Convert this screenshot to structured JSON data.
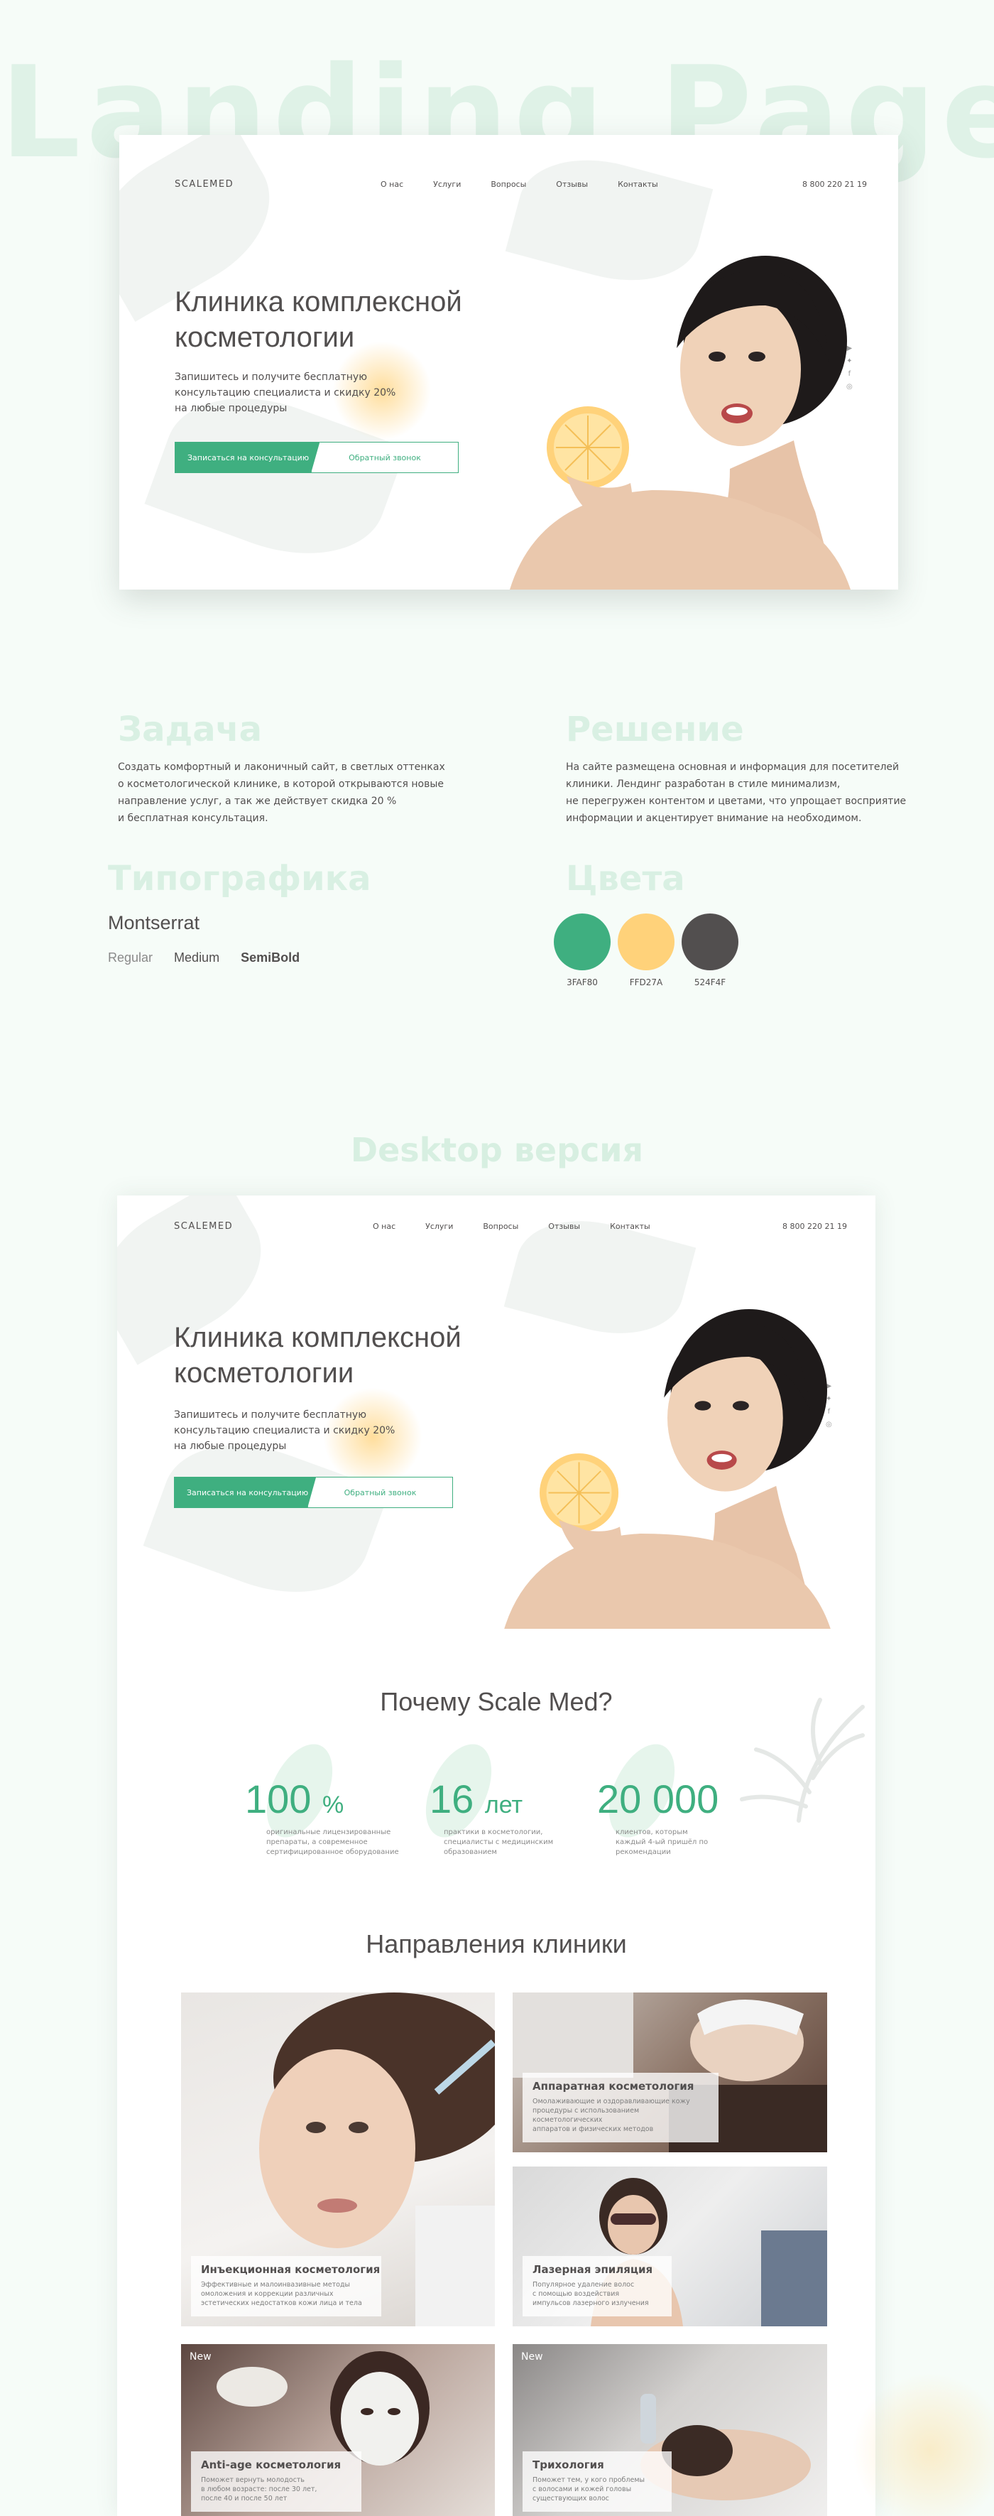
{
  "page_title": "Landing Page",
  "hero": {
    "logo": "SCALEMED",
    "nav": [
      "О нас",
      "Услуги",
      "Вопросы",
      "Отзывы",
      "Контакты"
    ],
    "phone": "8 800 220 21 19",
    "title_line1": "Клиника комплексной",
    "title_line2": "косметологии",
    "sub_line1": "Запишитесь и получите бесплатную",
    "sub_line2": "консультацию специалиста и скидку 20%",
    "sub_line3": "на любые процедуры",
    "btn_primary": "Записаться на консультацию",
    "btn_secondary": "Обратный звонок",
    "social": [
      "▶",
      "✦",
      "f",
      "◎"
    ]
  },
  "task": {
    "title": "Задача",
    "line1": "Создать комфортный и лаконичный сайт, в светлых оттенках",
    "line2": "о косметологической клинике, в которой открываются новые",
    "line3": "направление услуг, а так же действует скидка 20 %",
    "line4": "и бесплатная консультация."
  },
  "solution": {
    "title": "Решение",
    "line1": "На сайте размещена основная и информация для посетителей",
    "line2": "клиники. Лендинг разработан в стиле минимализм,",
    "line3": "не перегружен контентом и цветами, что упрощает восприятие",
    "line4": "информации и акцентирует внимание на необходимом."
  },
  "typography": {
    "title": "Типографика",
    "font": "Montserrat",
    "weights": [
      "Regular",
      "Medium",
      "SemiBold"
    ]
  },
  "colors": {
    "title": "Цвета",
    "swatches": [
      {
        "hex": "#3FAF80",
        "label": "3FAF80"
      },
      {
        "hex": "#FFD27A",
        "label": "FFD27A"
      },
      {
        "hex": "#524F4F",
        "label": "524F4F"
      }
    ]
  },
  "desktop_title": "Desktop версия",
  "why": {
    "title": "Почему Scale Med?",
    "stats": [
      {
        "num": "100",
        "unit": "%",
        "l1": "оригинальные лицензированные",
        "l2": "препараты, а современное",
        "l3": "сертифицированное оборудование"
      },
      {
        "num": "16",
        "unit": "лет",
        "l1": "практики в косметологии,",
        "l2": "специалисты с медицинским",
        "l3": "образованием"
      },
      {
        "num": "20 000",
        "unit": "",
        "l1": "клиентов, котoрым",
        "l2": "каждый 4-ый пришёл по",
        "l3": "рекомендации"
      }
    ]
  },
  "directions": {
    "title": "Направления клиники",
    "tiles": [
      {
        "title": "Инъекционная косметология",
        "l1": "Эффективные и малоинвазивные методы",
        "l2": "омоложения и коррекции различных",
        "l3": "эстетических недостатков кожи лица и тела",
        "badge": ""
      },
      {
        "title": "Аппаратная косметология",
        "l1": "Омолаживающие и оздоравливающие кожу",
        "l2": "процедуры с использованием косметологических",
        "l3": "аппаратов и физических методов",
        "badge": ""
      },
      {
        "title": "Лазерная эпиляция",
        "l1": "Популярное удаление волос",
        "l2": "с помощью воздействия",
        "l3": "импульсов лазерного излучения",
        "badge": ""
      },
      {
        "title": "Anti-age косметология",
        "l1": "Поможет вернуть молодость",
        "l2": "в любом возрасте: после 30 лет,",
        "l3": "после 40 и после 50 лет",
        "badge": "New"
      },
      {
        "title": "Трихология",
        "l1": "Поможет тем, у кого проблемы",
        "l2": "с волосами и кожей головы",
        "l3": "существующих волос",
        "badge": "New"
      }
    ]
  }
}
